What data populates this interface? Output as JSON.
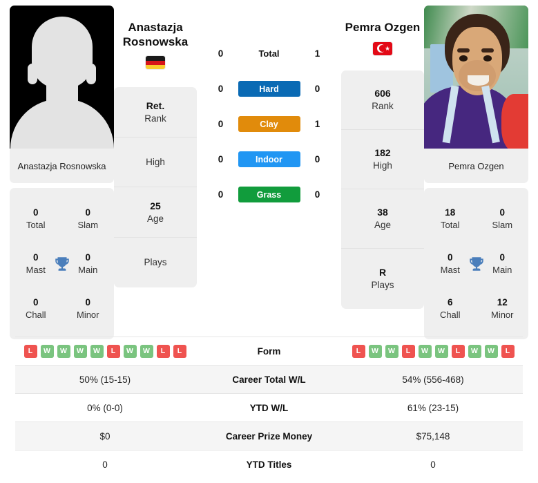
{
  "players": {
    "left": {
      "name_line1": "Anastazja",
      "name_line2": "Rosnowska",
      "full_name": "Anastazja Rosnowska",
      "photo_caption": "Anastazja Rosnowska",
      "flag": "germany-flag",
      "photo_type": "placeholder-silhouette",
      "stack": [
        {
          "value": "Ret.",
          "label": "Rank"
        },
        {
          "value": "",
          "label": "High"
        },
        {
          "value": "25",
          "label": "Age"
        },
        {
          "value": "",
          "label": "Plays"
        }
      ],
      "titles": [
        {
          "value": "0",
          "label": "Total"
        },
        {
          "value": "0",
          "label": "Slam"
        },
        {
          "value": "0",
          "label": "Mast"
        },
        {
          "value": "0",
          "label": "Main"
        },
        {
          "value": "0",
          "label": "Chall"
        },
        {
          "value": "0",
          "label": "Minor"
        }
      ],
      "form": [
        "L",
        "W",
        "W",
        "W",
        "W",
        "L",
        "W",
        "W",
        "L",
        "L"
      ],
      "surface_scores": {
        "total": "0",
        "hard": "0",
        "clay": "0",
        "indoor": "0",
        "grass": "0"
      },
      "career_total_wl": "50% (15-15)",
      "ytd_wl": "0% (0-0)",
      "career_prize_money": "$0",
      "ytd_titles": "0"
    },
    "right": {
      "name_line1": "Pemra Ozgen",
      "name_line2": "",
      "full_name": "Pemra Ozgen",
      "photo_caption": "Pemra Ozgen",
      "flag": "turkey-flag",
      "photo_type": "player-photo",
      "stack": [
        {
          "value": "606",
          "label": "Rank"
        },
        {
          "value": "182",
          "label": "High"
        },
        {
          "value": "38",
          "label": "Age"
        },
        {
          "value": "R",
          "label": "Plays"
        }
      ],
      "titles": [
        {
          "value": "18",
          "label": "Total"
        },
        {
          "value": "0",
          "label": "Slam"
        },
        {
          "value": "0",
          "label": "Mast"
        },
        {
          "value": "0",
          "label": "Main"
        },
        {
          "value": "6",
          "label": "Chall"
        },
        {
          "value": "12",
          "label": "Minor"
        }
      ],
      "form": [
        "L",
        "W",
        "W",
        "L",
        "W",
        "W",
        "L",
        "W",
        "W",
        "L"
      ],
      "surface_scores": {
        "total": "1",
        "hard": "0",
        "clay": "1",
        "indoor": "0",
        "grass": "0"
      },
      "career_total_wl": "54% (556-468)",
      "ytd_wl": "61% (23-15)",
      "career_prize_money": "$75,148",
      "ytd_titles": "0"
    }
  },
  "surfaces": [
    {
      "key": "total",
      "label": "Total",
      "color": "transparent",
      "text_color": "#111111"
    },
    {
      "key": "hard",
      "label": "Hard",
      "color": "#0a6ab4",
      "text_color": "#ffffff"
    },
    {
      "key": "clay",
      "label": "Clay",
      "color": "#e18b0b",
      "text_color": "#ffffff"
    },
    {
      "key": "indoor",
      "label": "Indoor",
      "color": "#2196f3",
      "text_color": "#ffffff"
    },
    {
      "key": "grass",
      "label": "Grass",
      "color": "#119c3c",
      "text_color": "#ffffff"
    }
  ],
  "table": {
    "rows": [
      {
        "label": "Form",
        "type": "form",
        "left": "",
        "right": ""
      },
      {
        "label": "Career Total W/L",
        "type": "text",
        "left": "50% (15-15)",
        "right": "54% (556-468)"
      },
      {
        "label": "YTD W/L",
        "type": "text",
        "left": "0% (0-0)",
        "right": "61% (23-15)"
      },
      {
        "label": "Career Prize Money",
        "type": "text",
        "left": "$0",
        "right": "$75,148"
      },
      {
        "label": "YTD Titles",
        "type": "text",
        "left": "0",
        "right": "0"
      }
    ]
  },
  "colors": {
    "win": "#7ac47f",
    "loss": "#ef5350",
    "panel": "#efefef",
    "stripe": "#f5f5f5",
    "trophy": "#4a7ebb"
  },
  "icons": {
    "trophy": "trophy-icon"
  }
}
